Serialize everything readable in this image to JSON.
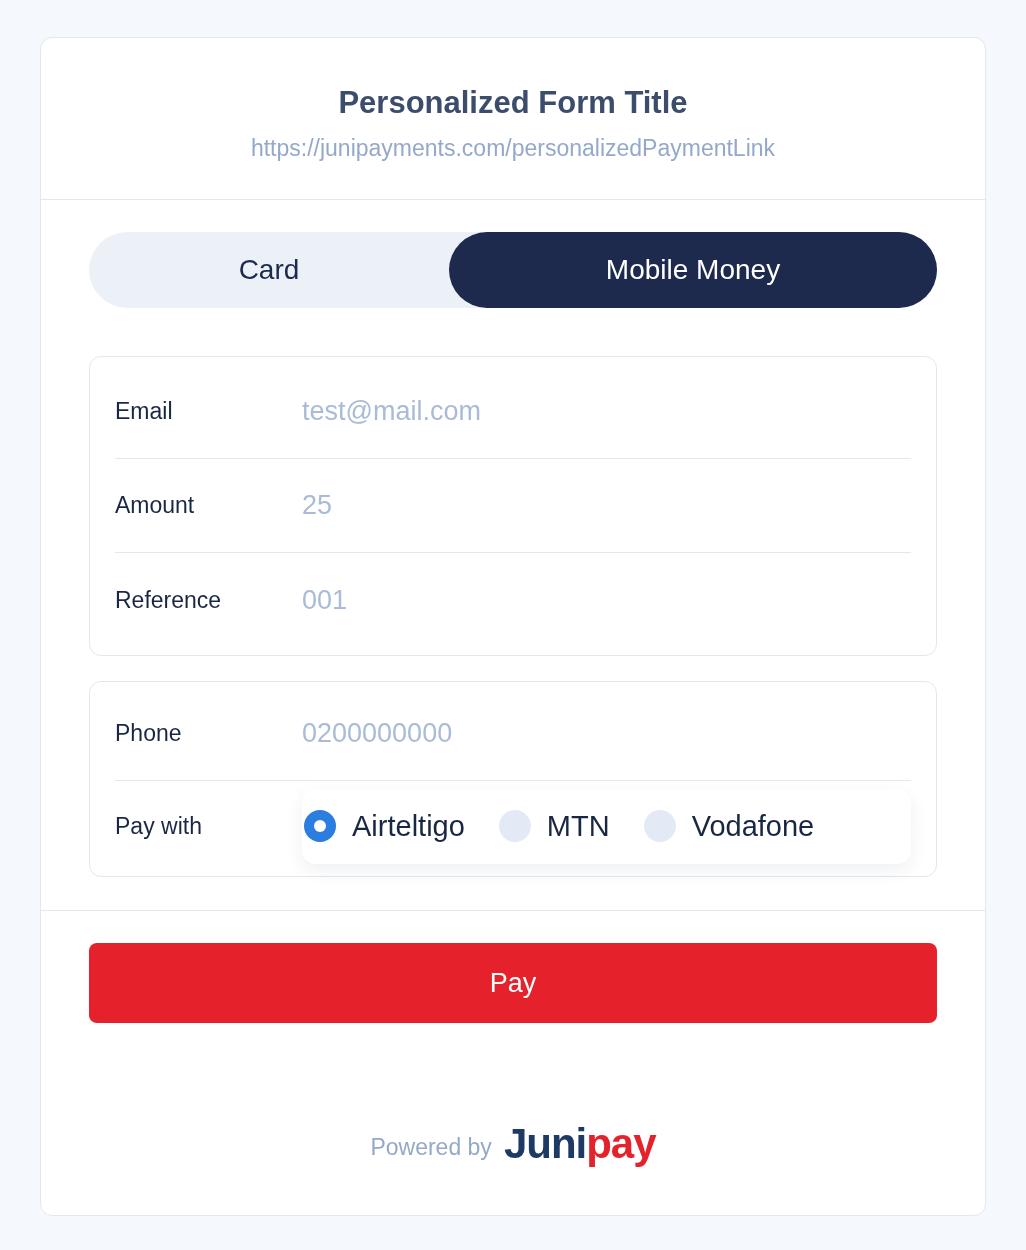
{
  "header": {
    "title": "Personalized Form Title",
    "url": "https://junipayments.com/personalizedPaymentLink"
  },
  "tabs": [
    {
      "label": "Card",
      "selected": false
    },
    {
      "label": "Mobile Money",
      "selected": true
    }
  ],
  "details": [
    {
      "label": "Email",
      "placeholder": "test@mail.com"
    },
    {
      "label": "Amount",
      "placeholder": "25"
    },
    {
      "label": "Reference",
      "placeholder": "001"
    }
  ],
  "mobile": {
    "phone": {
      "label": "Phone",
      "placeholder": "0200000000"
    },
    "pay_with": {
      "label": "Pay with",
      "options": [
        {
          "label": "Airteltigo",
          "selected": true
        },
        {
          "label": "MTN",
          "selected": false
        },
        {
          "label": "Vodafone",
          "selected": false
        }
      ]
    }
  },
  "pay_button": "Pay",
  "footer": {
    "powered_by": "Powered by",
    "logo": [
      {
        "text": "Juni",
        "color": "#1d3966"
      },
      {
        "text": "pay",
        "color": "#e4222b"
      }
    ]
  }
}
